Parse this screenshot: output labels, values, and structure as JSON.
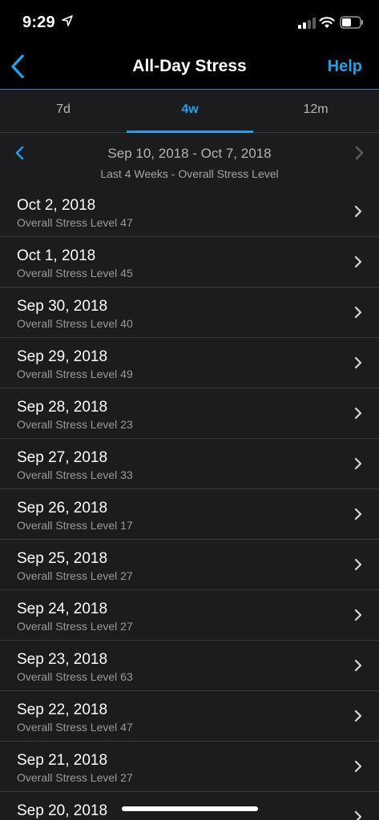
{
  "status_bar": {
    "time": "9:29"
  },
  "nav": {
    "title": "All-Day Stress",
    "help_label": "Help"
  },
  "tabs": [
    {
      "label": "7d"
    },
    {
      "label": "4w"
    },
    {
      "label": "12m"
    }
  ],
  "selected_tab": "4w",
  "range": {
    "title": "Sep 10, 2018 - Oct 7, 2018",
    "subtitle": "Last 4 Weeks - Overall Stress Level"
  },
  "days": [
    {
      "date": "Oct 2, 2018",
      "level": "Overall Stress Level 47"
    },
    {
      "date": "Oct 1, 2018",
      "level": "Overall Stress Level 45"
    },
    {
      "date": "Sep 30, 2018",
      "level": "Overall Stress Level 40"
    },
    {
      "date": "Sep 29, 2018",
      "level": "Overall Stress Level 49"
    },
    {
      "date": "Sep 28, 2018",
      "level": "Overall Stress Level 23"
    },
    {
      "date": "Sep 27, 2018",
      "level": "Overall Stress Level 33"
    },
    {
      "date": "Sep 26, 2018",
      "level": "Overall Stress Level 17"
    },
    {
      "date": "Sep 25, 2018",
      "level": "Overall Stress Level 27"
    },
    {
      "date": "Sep 24, 2018",
      "level": "Overall Stress Level 27"
    },
    {
      "date": "Sep 23, 2018",
      "level": "Overall Stress Level 63"
    },
    {
      "date": "Sep 22, 2018",
      "level": "Overall Stress Level 47"
    },
    {
      "date": "Sep 21, 2018",
      "level": "Overall Stress Level 27"
    },
    {
      "date": "Sep 20, 2018",
      "level": ""
    }
  ],
  "colors": {
    "accent": "#1fa1e8",
    "background": "#1c1c1e",
    "bar_background": "#000000"
  }
}
